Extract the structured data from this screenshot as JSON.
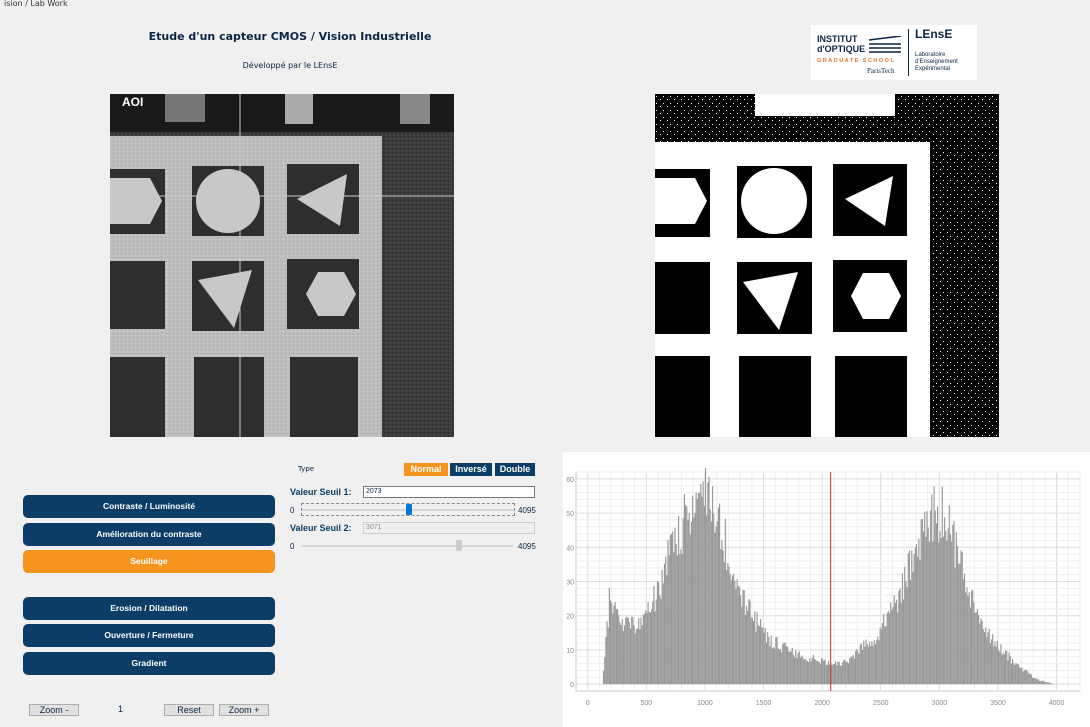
{
  "window": {
    "title": "ision / Lab Work"
  },
  "header": {
    "title": "Etude d'un capteur CMOS / Vision Industrielle",
    "subtitle": "Développé par le LEnsE"
  },
  "logo": {
    "institut_line1": "INSTITUT",
    "institut_line2": "d'OPTIQUE",
    "graduate": "GRADUATE SCHOOL",
    "paristech": "ParisTech",
    "lense": "LEnsE",
    "lab_line1": "Laboratoire",
    "lab_line2": "d'Enseignement",
    "lab_line3": "Expérimental"
  },
  "camera": {
    "overlay_label": "AOI"
  },
  "sidebar": {
    "items": [
      {
        "label": "Contraste / Luminosité",
        "active": false
      },
      {
        "label": "Amélioration du contraste",
        "active": false
      },
      {
        "label": "Seuillage",
        "active": true
      },
      {
        "label": "Erosion / Dilatation",
        "active": false
      },
      {
        "label": "Ouverture / Fermeture",
        "active": false
      },
      {
        "label": "Gradient",
        "active": false
      }
    ]
  },
  "zoom": {
    "zoom_minus": "Zoom -",
    "level": "1",
    "reset": "Reset",
    "zoom_plus": "Zoom +"
  },
  "threshold": {
    "type_label": "Type",
    "types": [
      {
        "label": "Normal",
        "active": true
      },
      {
        "label": "Inversé",
        "active": false
      },
      {
        "label": "Double",
        "active": false
      }
    ],
    "seuil1_label": "Valeur Seuil 1:",
    "seuil1_value": "2073",
    "seuil1_min": "0",
    "seuil1_max": "4095",
    "seuil2_label": "Valeur Seuil 2:",
    "seuil2_value": "3071",
    "seuil2_min": "0",
    "seuil2_max": "4095"
  },
  "chart_data": {
    "type": "bar",
    "title": "",
    "xlabel": "",
    "ylabel": "",
    "xlim": [
      -100,
      4200
    ],
    "ylim": [
      -2,
      62
    ],
    "xticks": [
      "0",
      "500",
      "1000",
      "1500",
      "2000",
      "2500",
      "3000",
      "3500",
      "4000"
    ],
    "yticks": [
      "0",
      "10",
      "20",
      "30",
      "40",
      "50",
      "60"
    ],
    "grid": true,
    "threshold_line": 2073,
    "bar_color": "#999999",
    "threshold_color": "#d02a2a",
    "x": [
      120,
      150,
      180,
      220,
      280,
      350,
      420,
      500,
      580,
      650,
      720,
      800,
      860,
      920,
      980,
      1020,
      1060,
      1100,
      1150,
      1200,
      1260,
      1320,
      1400,
      1480,
      1560,
      1650,
      1750,
      1850,
      1950,
      2050,
      2150,
      2250,
      2350,
      2450,
      2550,
      2650,
      2750,
      2820,
      2880,
      2940,
      3000,
      3050,
      3100,
      3150,
      3200,
      3260,
      3320,
      3400,
      3480,
      3560,
      3640,
      3720,
      3800,
      3860,
      3920,
      3980
    ],
    "values": [
      0,
      12,
      24,
      22,
      18,
      17,
      17,
      20,
      26,
      33,
      40,
      46,
      51,
      54,
      55,
      54,
      51,
      47,
      43,
      38,
      31,
      25,
      20,
      16,
      13,
      11,
      9,
      8,
      7,
      6,
      6,
      8,
      11,
      14,
      19,
      26,
      34,
      41,
      46,
      49,
      50,
      48,
      44,
      39,
      33,
      27,
      21,
      16,
      12,
      9,
      6,
      4,
      2,
      1,
      0.5,
      0
    ]
  }
}
